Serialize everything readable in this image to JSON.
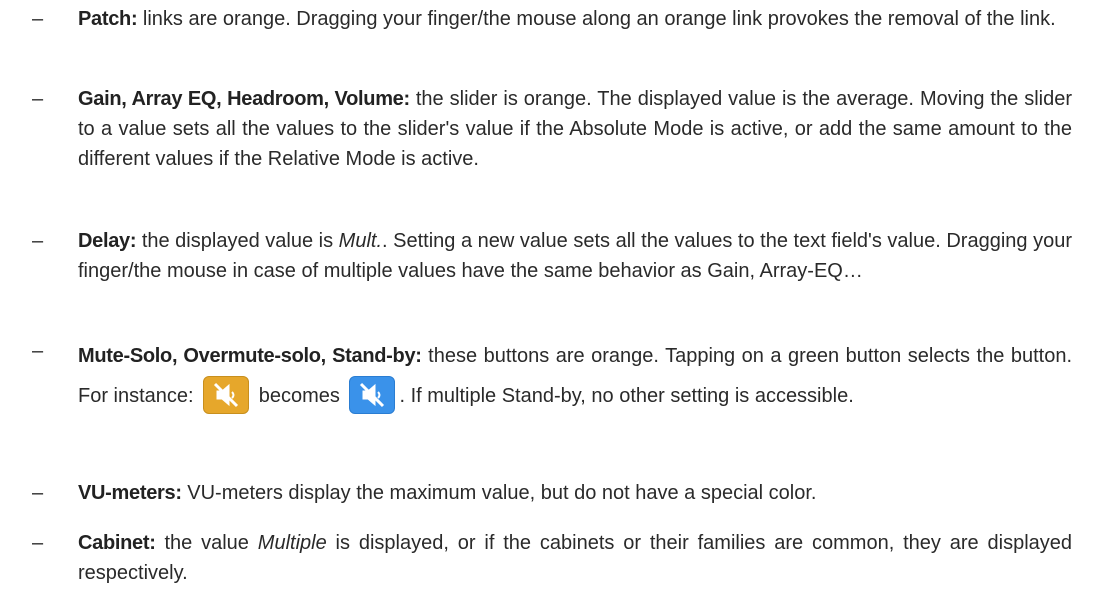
{
  "items": [
    {
      "term": "Patch:",
      "text": "links are orange. Dragging your finger/the mouse along an orange link provokes the removal of the link."
    },
    {
      "term": "Gain, Array EQ, Headroom, Volume:",
      "text": "the slider is orange. The displayed value is the average. Moving the slider to a value sets all the values to the slider's value if the Absolute Mode is active, or add the same amount to the different values if the Relative Mode is active."
    },
    {
      "term": "Delay:",
      "text_before": "the displayed value is ",
      "italic": "Mult.",
      "text_after": ". Setting a new value sets all the values to the text field's value. Dragging your finger/the mouse in case of multiple values have the same behavior as Gain, Array-EQ…"
    },
    {
      "term": "Mute-Solo, Overmute-solo, Stand-by:",
      "text_before": "these buttons are orange. Tapping on a green button selects the button. For instance:",
      "text_mid": "becomes",
      "text_after": ". If multiple Stand-by, no other setting is accessible."
    },
    {
      "term": "VU-meters:",
      "text": "VU-meters display the maximum value, but do not have a special color."
    },
    {
      "term": "Cabinet:",
      "text_before": "the value ",
      "italic": "Multiple",
      "text_after": " is displayed, or if the cabinets or their families are common, they are displayed respectively."
    }
  ],
  "bullet": "–",
  "icons": {
    "before": {
      "name": "mute-speaker-icon",
      "color": "#e6a72b"
    },
    "after": {
      "name": "mute-speaker-icon",
      "color": "#3a92ea"
    }
  }
}
